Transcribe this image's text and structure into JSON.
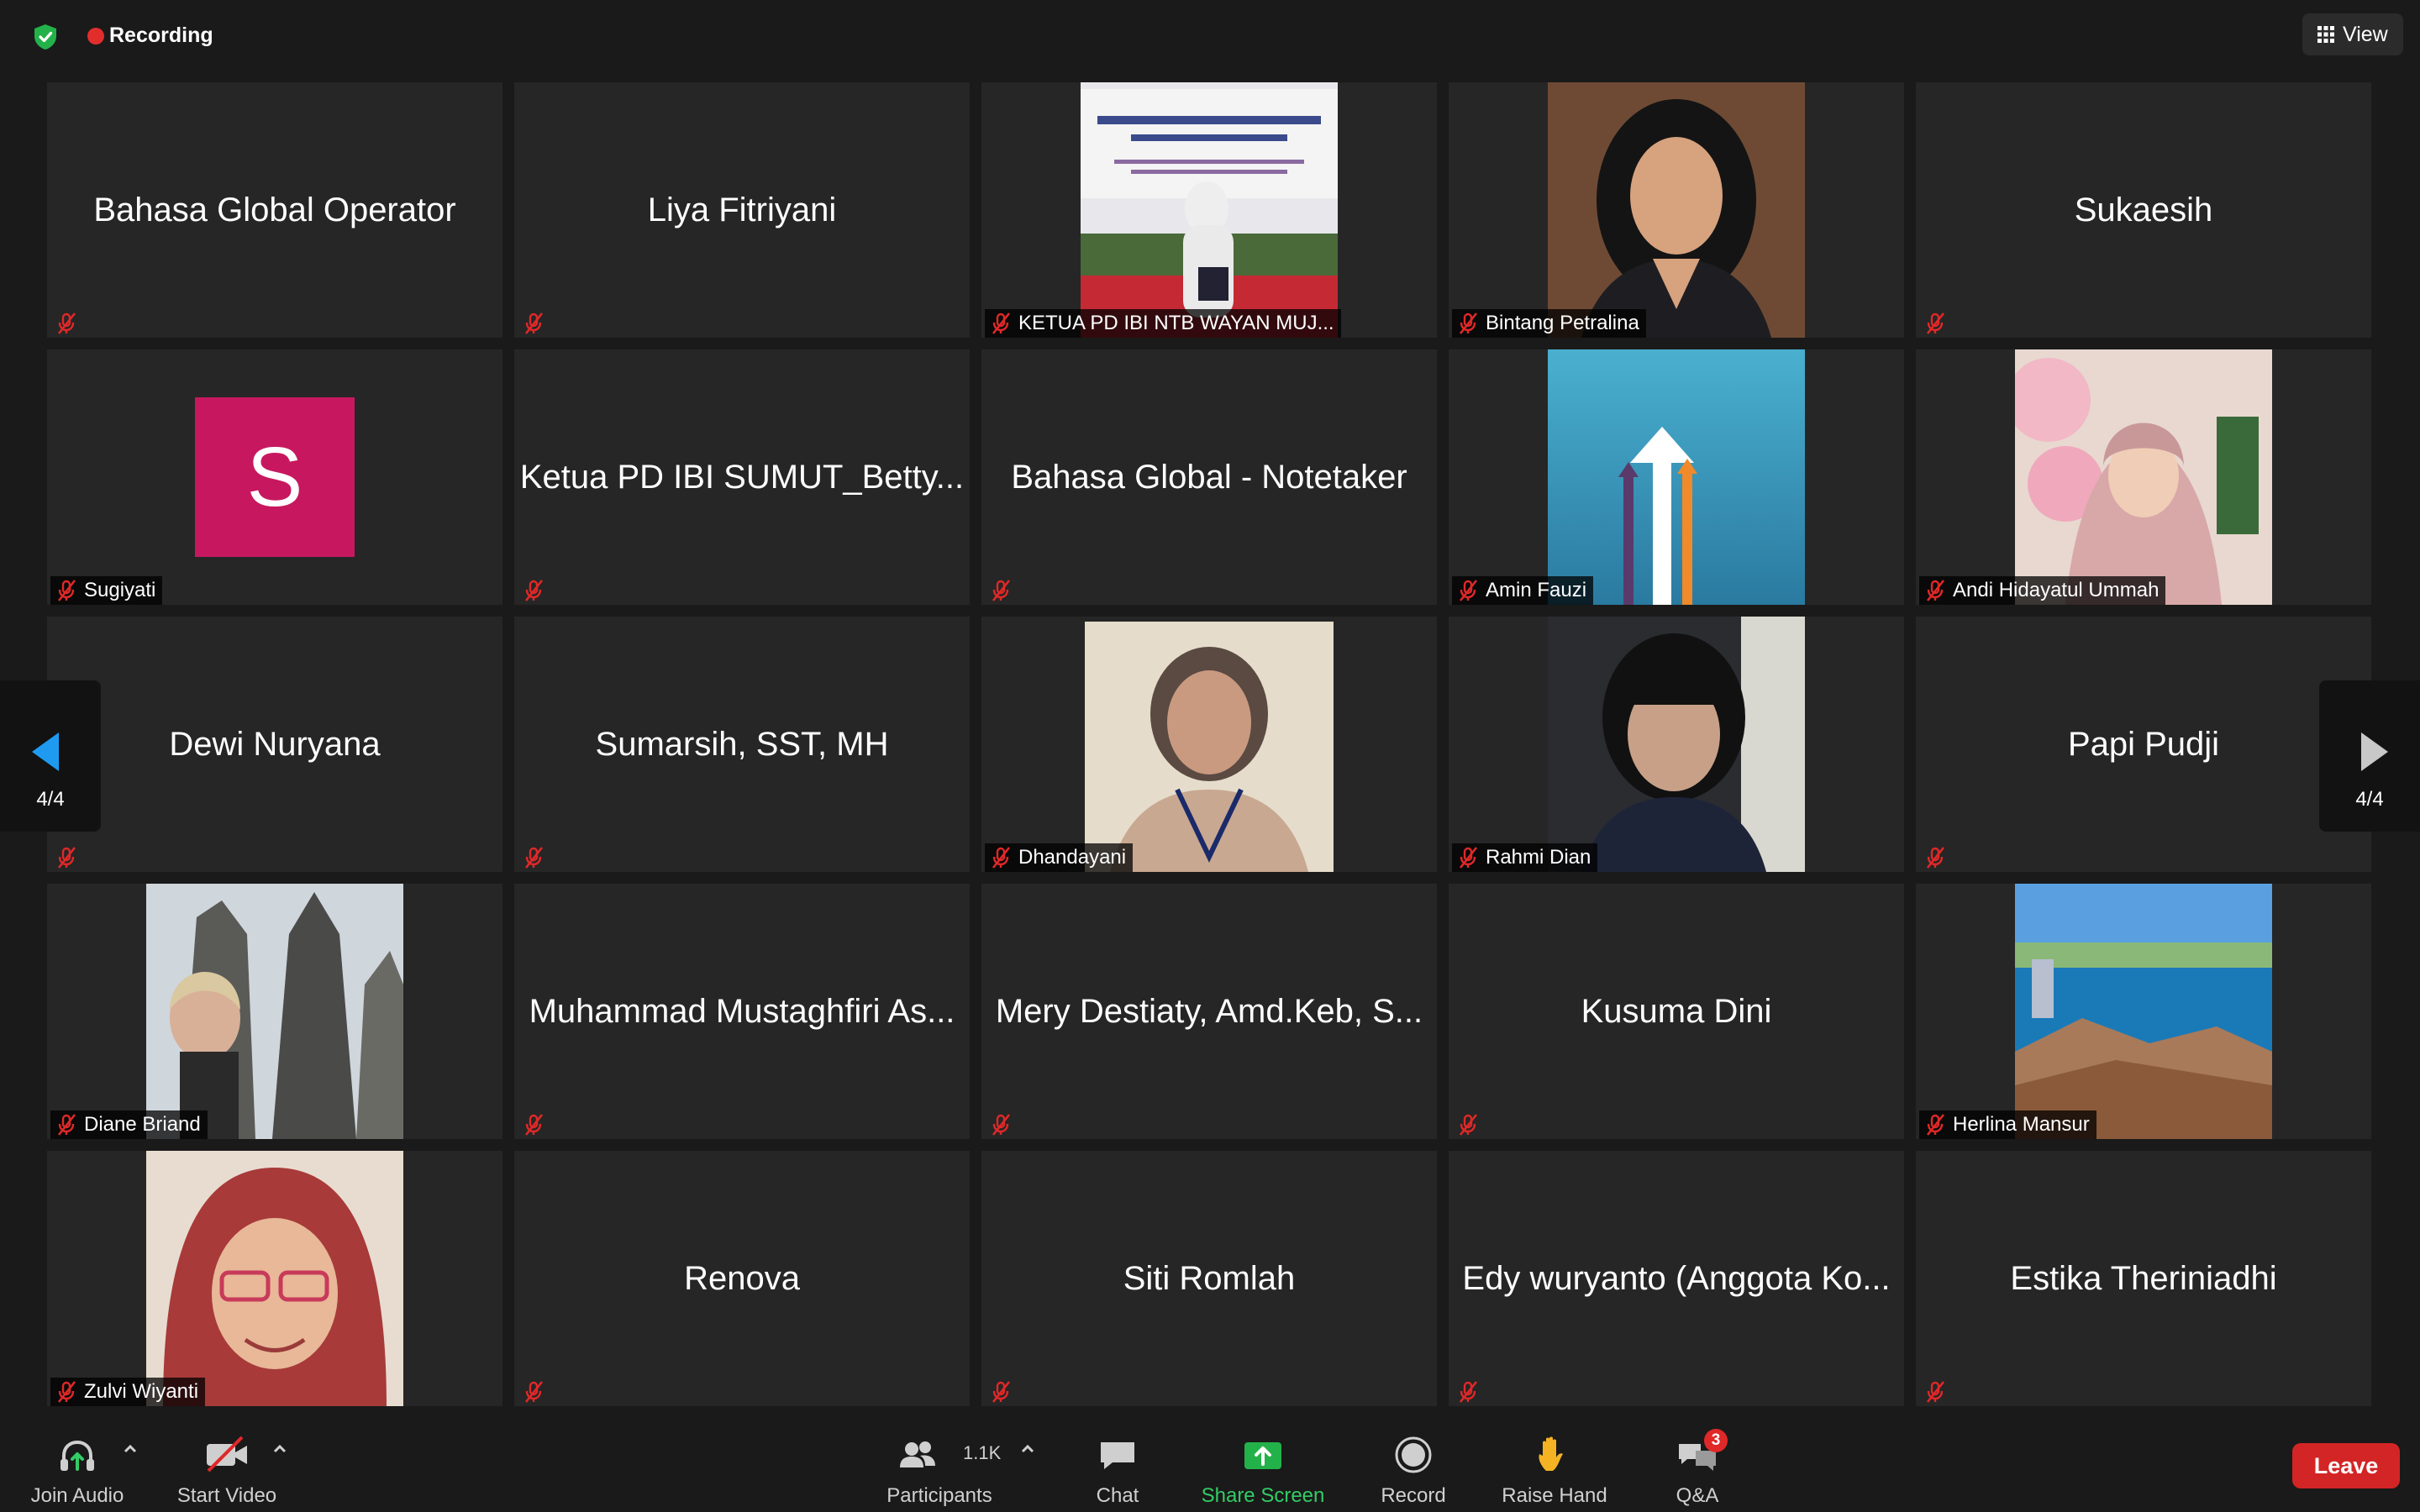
{
  "top": {
    "recording_label": "Recording",
    "view_label": "View"
  },
  "pager": {
    "left_label": "4/4",
    "right_label": "4/4"
  },
  "participants": [
    {
      "name": "Bahasa Global Operator"
    },
    {
      "name": "Liya Fitriyani"
    },
    {
      "name": "KETUA PD IBI NTB WAYAN MUJ..."
    },
    {
      "name": "Bintang Petralina"
    },
    {
      "name": "Sukaesih"
    },
    {
      "name": "Sugiyati",
      "avatar_letter": "S"
    },
    {
      "name": "Ketua PD IBI SUMUT_Betty..."
    },
    {
      "name": "Bahasa Global - Notetaker"
    },
    {
      "name": "Amin Fauzi"
    },
    {
      "name": "Andi Hidayatul Ummah"
    },
    {
      "name": "Dewi Nuryana"
    },
    {
      "name": "Sumarsih, SST, MH"
    },
    {
      "name": "Dhandayani"
    },
    {
      "name": "Rahmi Dian"
    },
    {
      "name": "Papi Pudji"
    },
    {
      "name": "Diane Briand"
    },
    {
      "name": "Muhammad Mustaghfiri As..."
    },
    {
      "name": "Mery Destiaty, Amd.Keb, S..."
    },
    {
      "name": "Kusuma Dini"
    },
    {
      "name": "Herlina Mansur"
    },
    {
      "name": "Zulvi Wiyanti"
    },
    {
      "name": "Renova"
    },
    {
      "name": "Siti Romlah"
    },
    {
      "name": "Edy wuryanto (Anggota Ko..."
    },
    {
      "name": "Estika Theriniadhi"
    }
  ],
  "toolbar": {
    "join_audio": "Join Audio",
    "start_video": "Start Video",
    "participants": "Participants",
    "participants_count": "1.1K",
    "chat": "Chat",
    "share_screen": "Share Screen",
    "record": "Record",
    "raise_hand": "Raise Hand",
    "qa": "Q&A",
    "qa_badge": "3",
    "leave": "Leave"
  },
  "colors": {
    "accent_green": "#33cc66",
    "leave_red": "#d32525",
    "recording_red": "#e22d2d",
    "avatar_pink": "#c7185f"
  }
}
